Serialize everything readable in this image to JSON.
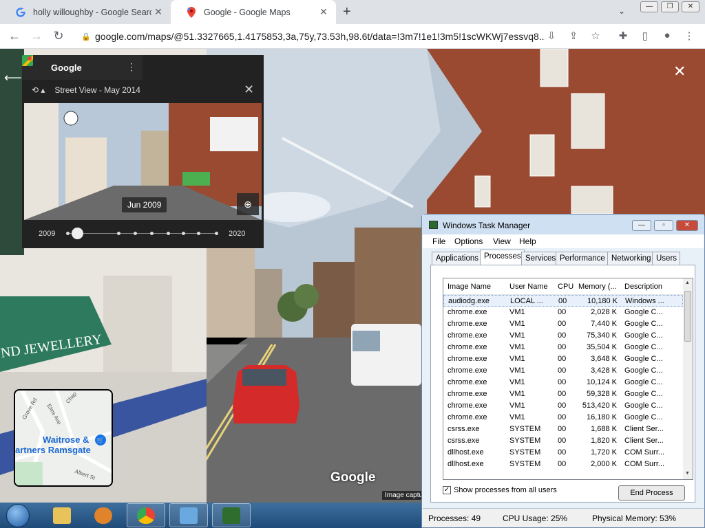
{
  "browser": {
    "tabs": [
      {
        "title": "holly willoughby - Google Search",
        "icon": "google-g-icon"
      },
      {
        "title": "Google - Google Maps",
        "icon": "maps-pin-icon",
        "active": true
      }
    ],
    "url": "google.com/maps/@51.3327665,1.4175853,3a,75y,73.53h,98.6t/data=!3m7!1e1!3m5!1scWKWj7essvq8..."
  },
  "streetview": {
    "panel": {
      "brand": "Google",
      "subtitle": "Street View - May 2014",
      "thumb_date": "Jun 2009",
      "timeline_start": "2009",
      "timeline_end": "2020",
      "timeline_position": 0.1
    },
    "watermark": "Google",
    "image_caption": "Image captu",
    "minimap": {
      "poi": "Waitrose &\nPartners Ramsgate",
      "poi_line1": "Waitrose &",
      "poi_line2": "artners Ramsgate",
      "streets": [
        "Grove Rd",
        "Elms Ave",
        "Chap",
        "Albert St"
      ]
    }
  },
  "taskmanager": {
    "title": "Windows Task Manager",
    "menu": [
      "File",
      "Options",
      "View",
      "Help"
    ],
    "tabs": [
      "Applications",
      "Processes",
      "Services",
      "Performance",
      "Networking",
      "Users"
    ],
    "active_tab": "Processes",
    "columns": [
      "Image Name",
      "User Name",
      "CPU",
      "Memory (...",
      "Description"
    ],
    "rows": [
      [
        "audiodg.exe",
        "LOCAL ...",
        "00",
        "10,180 K",
        "Windows ..."
      ],
      [
        "chrome.exe",
        "VM1",
        "00",
        "2,028 K",
        "Google C..."
      ],
      [
        "chrome.exe",
        "VM1",
        "00",
        "7,440 K",
        "Google C..."
      ],
      [
        "chrome.exe",
        "VM1",
        "00",
        "75,340 K",
        "Google C..."
      ],
      [
        "chrome.exe",
        "VM1",
        "00",
        "35,504 K",
        "Google C..."
      ],
      [
        "chrome.exe",
        "VM1",
        "00",
        "3,648 K",
        "Google C..."
      ],
      [
        "chrome.exe",
        "VM1",
        "00",
        "3,428 K",
        "Google C..."
      ],
      [
        "chrome.exe",
        "VM1",
        "00",
        "10,124 K",
        "Google C..."
      ],
      [
        "chrome.exe",
        "VM1",
        "00",
        "59,328 K",
        "Google C..."
      ],
      [
        "chrome.exe",
        "VM1",
        "00",
        "513,420 K",
        "Google C..."
      ],
      [
        "chrome.exe",
        "VM1",
        "00",
        "16,180 K",
        "Google C..."
      ],
      [
        "csrss.exe",
        "SYSTEM",
        "00",
        "1,688 K",
        "Client Ser..."
      ],
      [
        "csrss.exe",
        "SYSTEM",
        "00",
        "1,820 K",
        "Client Ser..."
      ],
      [
        "dllhost.exe",
        "SYSTEM",
        "00",
        "1,720 K",
        "COM Surr..."
      ],
      [
        "dllhost.exe",
        "SYSTEM",
        "00",
        "2,000 K",
        "COM Surr..."
      ]
    ],
    "show_all_label": "Show processes from all users",
    "show_all_checked": true,
    "end_process_label": "End Process",
    "status": {
      "processes": "Processes: 49",
      "cpu": "CPU Usage: 25%",
      "memory": "Physical Memory: 53%"
    }
  },
  "colors": {
    "tm_frame": "#cfe0f3",
    "taskbar": "#2a5a8a",
    "chrome_tab_bg": "#dee1e6"
  }
}
